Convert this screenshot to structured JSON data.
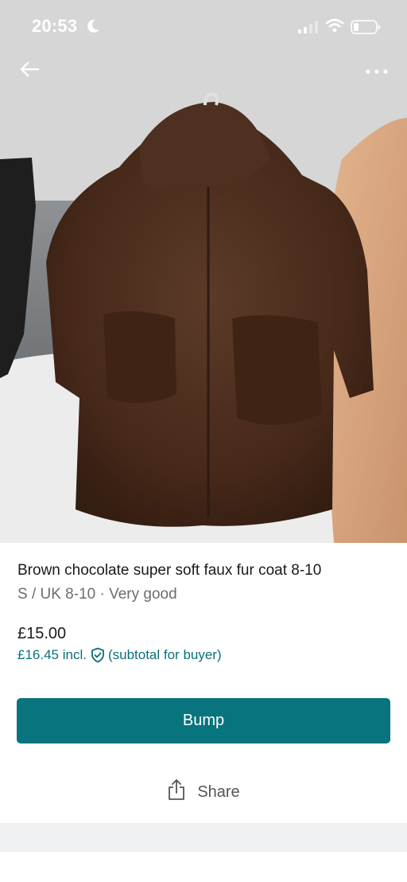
{
  "status_bar": {
    "time": "20:53",
    "icons": [
      "moon-icon",
      "signal-icon",
      "wifi-icon",
      "battery-icon"
    ]
  },
  "nav": {
    "back_icon": "arrow-left-icon",
    "more_icon": "more-dots-icon"
  },
  "listing": {
    "title": "Brown chocolate super soft faux fur coat 8-10",
    "meta": "S / UK 8-10 · Very good",
    "price": "£15.00",
    "price_incl": "£16.45 incl.",
    "price_incl_note": "(subtotal for buyer)"
  },
  "actions": {
    "bump_label": "Bump",
    "share_label": "Share"
  },
  "colors": {
    "accent": "#08747e",
    "link": "#0b6f79",
    "muted_text": "#6d6d6d"
  }
}
